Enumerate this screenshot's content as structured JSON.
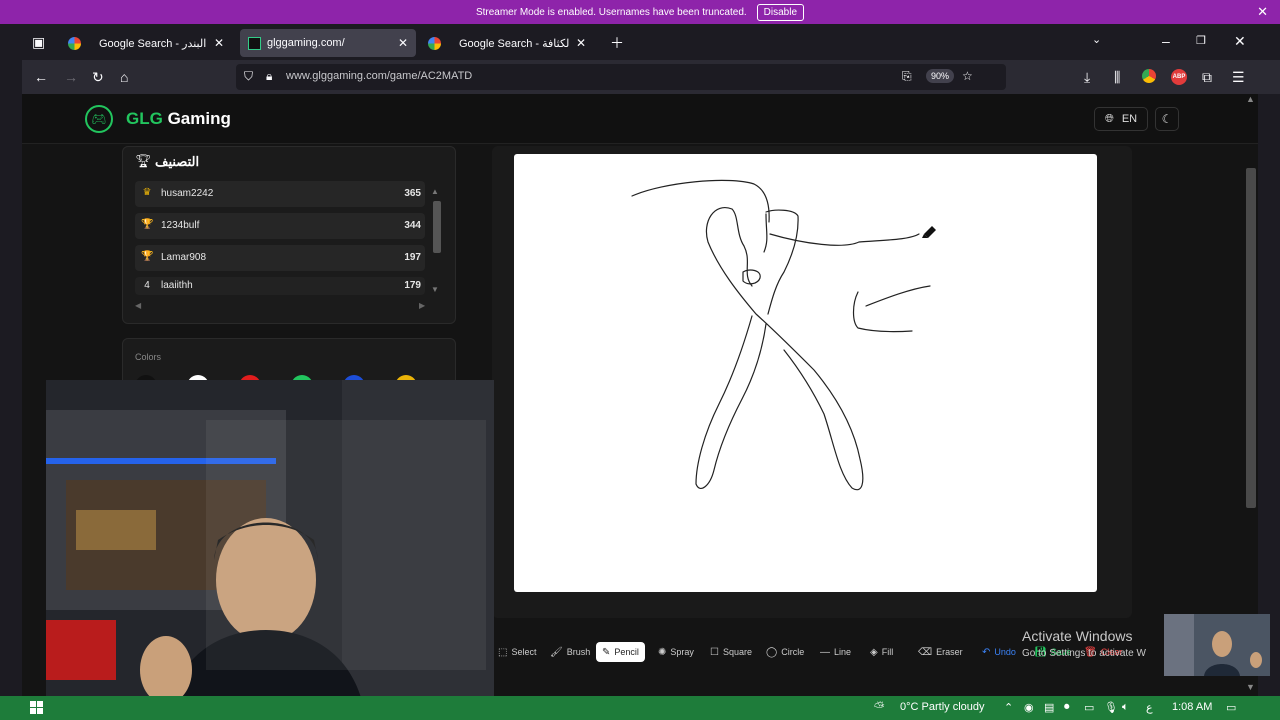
{
  "banner": {
    "message": "Streamer Mode is enabled. Usernames have been truncated.",
    "disable_label": "Disable"
  },
  "browser": {
    "tabs": [
      {
        "label": "Google Search - ما هو البندر",
        "active": false
      },
      {
        "label": "glggaming.com/",
        "active": true
      },
      {
        "label": "Google Search - صيغة الكثافة",
        "active": false
      }
    ],
    "url": "www.glggaming.com/game/AC2MATD",
    "zoom": "90%",
    "extension_badge": "ABP"
  },
  "site": {
    "brand_accent": "GLG",
    "brand_rest": " Gaming",
    "language": "EN"
  },
  "leaderboard": {
    "title": "التصنيف",
    "rows": [
      {
        "rank": "♛",
        "name": "husam2242",
        "score": "365"
      },
      {
        "rank": "🏆",
        "name": "1234bulf",
        "score": "344"
      },
      {
        "rank": "🏆",
        "name": "Lamar908",
        "score": "197"
      },
      {
        "rank": "4",
        "name": "laaiithh",
        "score": "179"
      }
    ]
  },
  "colors": {
    "label": "Colors",
    "swatches": [
      "#111111",
      "#ffffff",
      "#e11d1d",
      "#22c55e",
      "#1d4ed8",
      "#eab308"
    ]
  },
  "toolbar": {
    "tools": [
      {
        "label": "Select",
        "icon": "select-icon"
      },
      {
        "label": "Brush",
        "icon": "brush-icon"
      },
      {
        "label": "Pencil",
        "icon": "pencil-icon",
        "active": true
      },
      {
        "label": "Spray",
        "icon": "spray-icon"
      },
      {
        "label": "Square",
        "icon": "square-icon"
      },
      {
        "label": "Circle",
        "icon": "circle-icon"
      },
      {
        "label": "Line",
        "icon": "line-icon"
      },
      {
        "label": "Fill",
        "icon": "fill-icon"
      },
      {
        "label": "Eraser",
        "icon": "eraser-icon"
      },
      {
        "label": "Undo",
        "icon": "undo-icon"
      },
      {
        "label": "Save",
        "icon": "save-icon"
      },
      {
        "label": "Clear",
        "icon": "clear-icon"
      }
    ]
  },
  "watermark": {
    "line1": "Activate Windows",
    "line2": "Go to Settings to activate W"
  },
  "taskbar": {
    "weather": "0°C  Partly cloudy",
    "lang": "ع",
    "time": "1:08 AM"
  }
}
